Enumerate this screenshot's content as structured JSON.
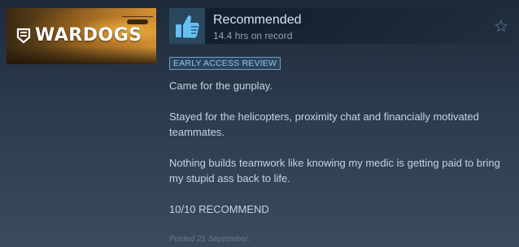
{
  "game": {
    "name": "WARDOGS"
  },
  "review": {
    "verdict": "Recommended",
    "hours": "14.4 hrs on record",
    "badge": "EARLY ACCESS REVIEW",
    "paragraphs": [
      "Came for the gunplay.",
      "Stayed for the helicopters, proximity chat and financially motivated teammates.",
      "Nothing builds teamwork like knowing my medic is getting paid to bring my stupid ass back to life.",
      "10/10 RECOMMEND"
    ],
    "posted": "Posted 21 September."
  },
  "icons": {
    "verdict_icon": "thumbs-up-icon",
    "favorite_icon": "star-icon",
    "logo_icon": "wardogs-logo-icon"
  },
  "colors": {
    "thumb_bg": "#2a475e",
    "thumb_icon": "#66c0f4",
    "badge_border": "#6b9cc4",
    "badge_text": "#8fc4e8"
  }
}
